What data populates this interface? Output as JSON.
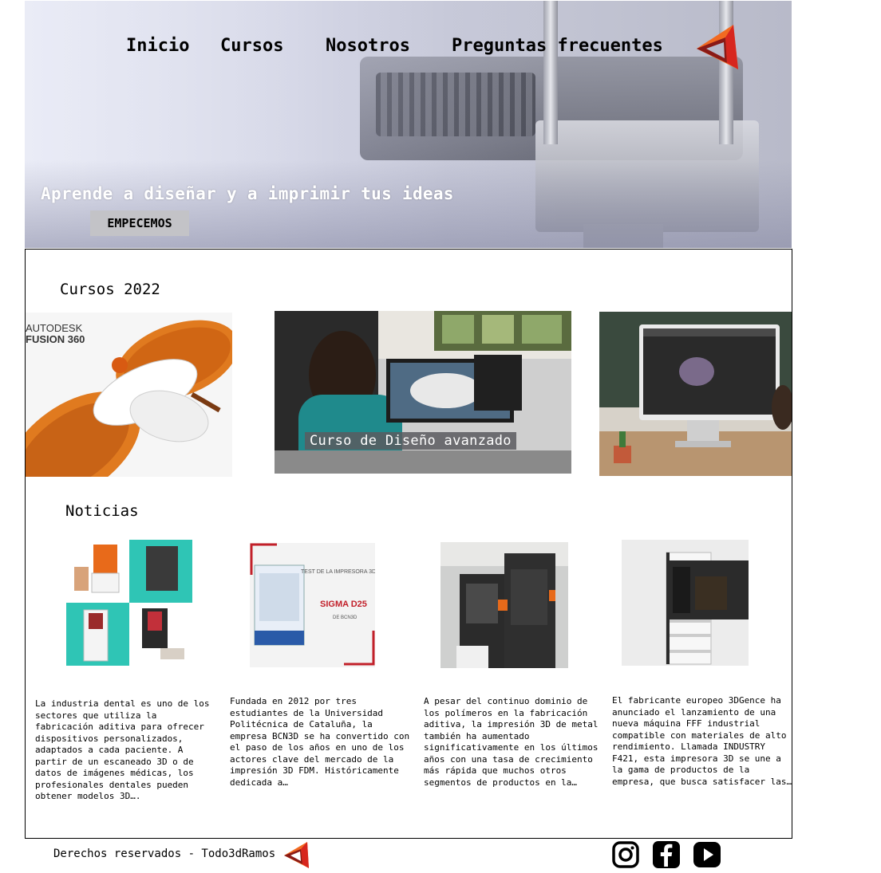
{
  "nav": {
    "items": [
      "Inicio",
      "Cursos",
      "Nosotros",
      "Preguntas frecuentes"
    ]
  },
  "hero": {
    "title": "Aprende a diseñar y a imprimir tus ideas",
    "cta_label": "EMPECEMOS"
  },
  "courses": {
    "section_title": "Cursos 2022",
    "items": [
      {
        "image": "autodesk-fusion-360-image",
        "brand_text": "AUTODESK\nFUSION 360"
      },
      {
        "image": "woman-designing-at-computer-image",
        "label": "Curso de Diseño avanzado"
      },
      {
        "image": "imac-3d-model-image"
      }
    ]
  },
  "news": {
    "section_title": "Noticias",
    "items": [
      {
        "image": "dental-3d-printers-image",
        "text": "La industria dental es uno de los sectores que utiliza la fabricación aditiva para ofrecer dispositivos personalizados, adaptados a cada paciente. A partir de un escaneado 3D o de datos de imágenes médicas, los profesionales dentales pueden obtener modelos 3D…."
      },
      {
        "image": "sigma-d25-printer-image",
        "image_text": "TEST DE LA IMPRESORA 3D\nSIGMA D25\nDE BCN3D",
        "text": "Fundada en 2012 por tres estudiantes de la Universidad Politécnica de Cataluña, la empresa BCN3D se ha convertido con el paso de los años en uno de los actores clave del mercado de la impresión 3D FDM. Históricamente dedicada a…"
      },
      {
        "image": "metal-3d-printers-image",
        "text": "A pesar del continuo dominio de los polímeros en la fabricación aditiva, la impresión 3D de metal también ha aumentado significativamente en los últimos años con una tasa de crecimiento más rápida que muchos otros segmentos de productos en la…"
      },
      {
        "image": "3dgence-industry-f421-image",
        "text": "El fabricante europeo 3DGence ha anunciado el lanzamiento de una nueva máquina FFF industrial compatible con materiales de alto rendimiento. Llamada INDUSTRY F421, esta impresora 3D se une a la gama de productos de la empresa, que busca satisfacer las…"
      }
    ]
  },
  "footer": {
    "text": "Derechos reservados - Todo3dRamos",
    "social": [
      "instagram-icon",
      "facebook-icon",
      "youtube-icon"
    ]
  },
  "colors": {
    "logo_orange": "#f26a21",
    "logo_red": "#d7261e",
    "logo_dark": "#8a1a16",
    "cta_bg": "#c3c3c7",
    "teal": "#2fc5b5"
  }
}
